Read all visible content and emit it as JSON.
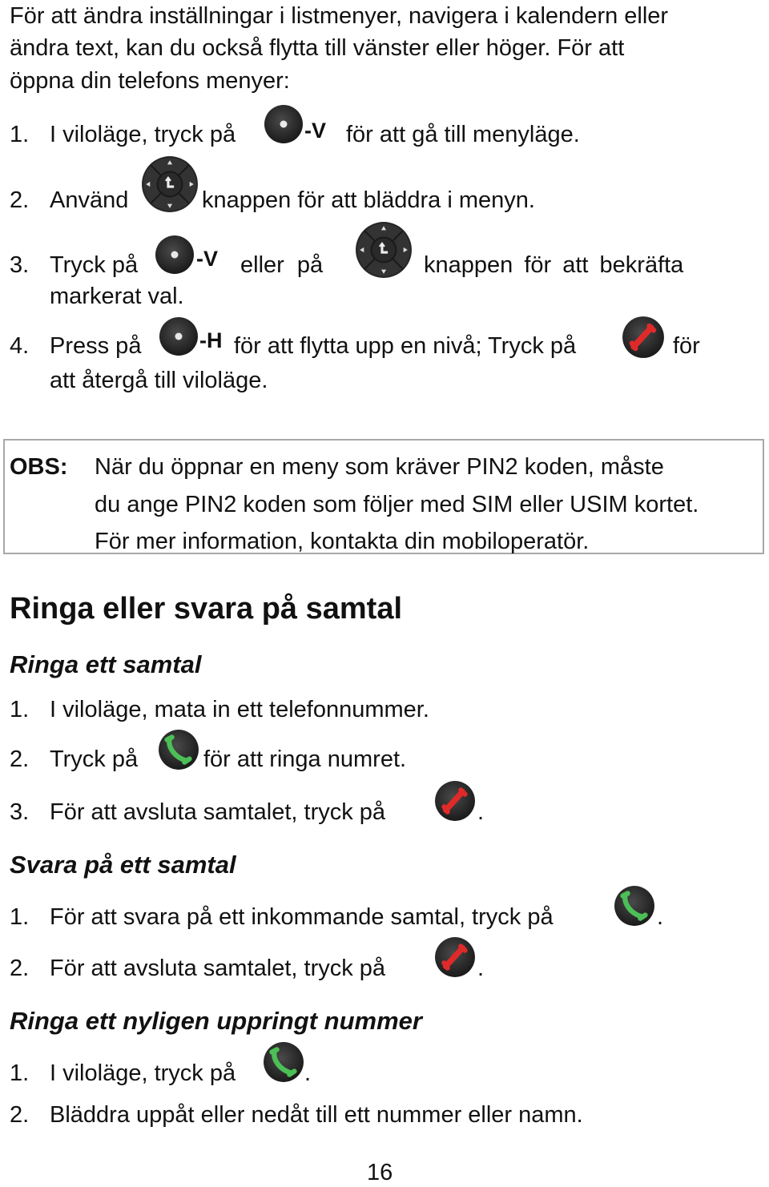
{
  "intro": [
    "För att ändra inställningar i listmenyer, navigera i kalendern eller",
    "ändra text, kan du också flytta till vänster eller höger. För att",
    "öppna din telefons menyer:"
  ],
  "menu_steps": [
    {
      "num": "1.",
      "pre": "I viloläge, tryck på",
      "key": "-V",
      "post": "för att gå till menyläge."
    },
    {
      "num": "2.",
      "pre": "Använd",
      "post": "knappen för att bläddra i menyn."
    },
    {
      "num": "3.",
      "pre": "Tryck på",
      "key": "-V",
      "mid": "eller  på",
      "post": "knappen  för  att  bekräfta",
      "cont": "markerat val."
    },
    {
      "num": "4.",
      "pre": "Press på",
      "key": "-H",
      "post": "för att flytta upp en nivå; Tryck på",
      "tail": "för",
      "cont": "att återgå till viloläge."
    }
  ],
  "obs": {
    "label": "OBS:",
    "lines": [
      "När du öppnar en meny som kräver PIN2 koden, måste",
      "du ange PIN2 koden som följer med SIM eller USIM kortet.",
      "För mer information, kontakta din mobiloperatör."
    ]
  },
  "section_title": "Ringa eller svara på samtal",
  "call": {
    "title": "Ringa ett samtal",
    "steps": [
      {
        "num": "1.",
        "text": "I viloläge, mata in ett telefonnummer."
      },
      {
        "num": "2.",
        "pre": "Tryck på",
        "post": "för att ringa numret."
      },
      {
        "num": "3.",
        "pre": "För att avsluta samtalet, tryck på",
        "post": "."
      }
    ]
  },
  "answer": {
    "title": "Svara på ett samtal",
    "steps": [
      {
        "num": "1.",
        "pre": "För att svara på ett inkommande samtal, tryck på",
        "post": "."
      },
      {
        "num": "2.",
        "pre": "För att avsluta samtalet, tryck på",
        "post": "."
      }
    ]
  },
  "redial": {
    "title": "Ringa ett nyligen uppringt nummer",
    "steps": [
      {
        "num": "1.",
        "pre": "I viloläge, tryck på",
        "post": "."
      },
      {
        "num": "2.",
        "text": "Bläddra uppåt eller nedåt till ett nummer eller namn."
      }
    ]
  },
  "icons": {
    "softkey": "softkey-icon",
    "nav": "nav-pad-icon",
    "end": "end-call-icon",
    "call": "call-icon"
  },
  "colors": {
    "key_dark": "#2b2b2b",
    "call_green": "#4cbf56",
    "end_red": "#e02a2a"
  },
  "page_number": "16"
}
